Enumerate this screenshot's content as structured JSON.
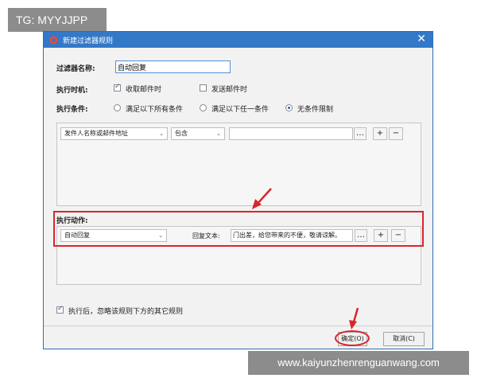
{
  "watermark": {
    "top_left": "TG: MYYJJPP",
    "bottom_right": "www.kaiyunzhenrenguanwang.com"
  },
  "dialog": {
    "title": "新建过滤器规则",
    "close_icon": "✕",
    "name_label": "过滤器名称:",
    "name_value": "自动回复",
    "timing_label": "执行时机:",
    "timing_options": [
      {
        "label": "收取邮件时",
        "checked": true
      },
      {
        "label": "发送邮件时",
        "checked": false
      }
    ],
    "condition_label": "执行条件:",
    "condition_options": [
      {
        "label": "满足以下所有条件",
        "selected": false
      },
      {
        "label": "满足以下任一条件",
        "selected": false
      },
      {
        "label": "无条件限制",
        "selected": true
      }
    ],
    "condition_row": {
      "field_select": "发件人名称或邮件地址",
      "operator_select": "包含",
      "value": "",
      "more_button": "…",
      "add_button": "+",
      "remove_button": "−"
    },
    "action_label": "执行动作:",
    "action_row": {
      "action_select": "自动回复",
      "reply_label": "回复文本:",
      "reply_value": "门出差，给您带来的不便，敬请谅解。",
      "more_button": "…",
      "add_button": "+",
      "remove_button": "−"
    },
    "ignore_option": {
      "label": "执行后，忽略该规则下方的其它规则",
      "checked": true
    },
    "ok_button": "确定(O)",
    "cancel_button": "取消(C)"
  },
  "colors": {
    "titlebar": "#3478c8",
    "annotation_red": "#d8262c"
  },
  "icons": [
    "app-logo-icon",
    "close-icon",
    "checkbox-icon",
    "radio-icon",
    "chevron-down-icon",
    "ellipsis-icon",
    "plus-icon",
    "minus-icon",
    "red-arrow-annotation-icon"
  ]
}
